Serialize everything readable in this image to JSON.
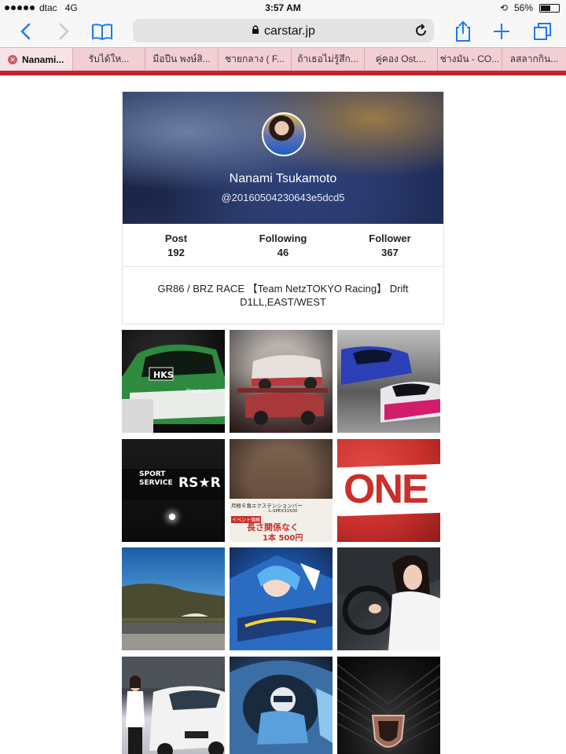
{
  "status_bar": {
    "carrier": "dtac",
    "network": "4G",
    "time": "3:57 AM",
    "battery_percent": "56%",
    "battery_level": 0.56
  },
  "browser": {
    "url": "carstar.jp",
    "tabs": [
      {
        "label": "Nanami...",
        "active": true
      },
      {
        "label": "รับได้ให...",
        "active": false
      },
      {
        "label": "มือปืน พงษ์สิ...",
        "active": false
      },
      {
        "label": "ชายกลาง ( F...",
        "active": false
      },
      {
        "label": "ถ้าเธอไม่รู้สึก...",
        "active": false
      },
      {
        "label": "คู่คอง Ost....",
        "active": false
      },
      {
        "label": "ช่างมัน - CO...",
        "active": false
      },
      {
        "label": "ลสลากกิน...",
        "active": false
      }
    ],
    "accent_color": "#1a7bf2",
    "progress_color": "#c52030"
  },
  "profile": {
    "name": "Nanami Tsukamoto",
    "handle": "@20160504230643e5dcd5",
    "stats": [
      {
        "label": "Post",
        "value": "192"
      },
      {
        "label": "Following",
        "value": "46"
      },
      {
        "label": "Follower",
        "value": "367"
      }
    ],
    "bio": "GR86 / BRZ RACE 【Team NetzTOKYO Racing】 Drift D1LL,EAST/WEST"
  },
  "photos": {
    "texts": {
      "hks": "HKS",
      "firestone": "Firestone",
      "sport_service_line1": "SPORT",
      "sport_service_line2": "SERVICE",
      "rs_r": "RS★R",
      "poster_line1": "月極６角エクステンションバー",
      "poster_line2": "L-SPEX31500",
      "poster_line3": "イベント価格",
      "poster_line4": "長さ関係なく",
      "poster_line5": "1本 500円",
      "one": "ONE"
    }
  }
}
